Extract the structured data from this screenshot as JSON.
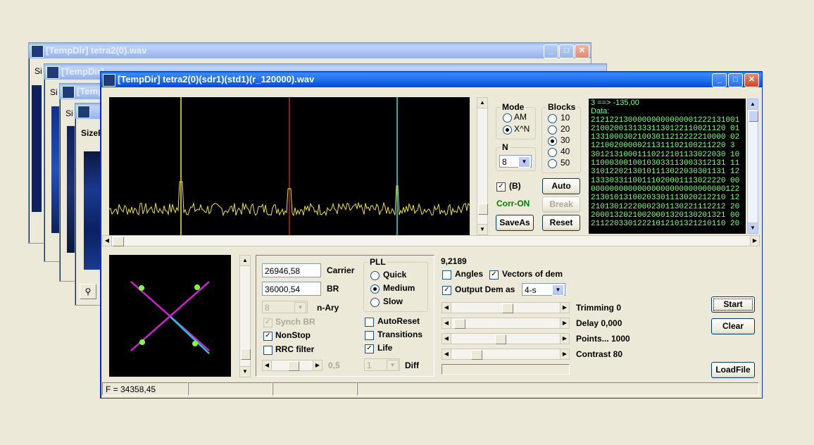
{
  "windows_back": [
    {
      "title": "[TempDir] tetra2(0).wav",
      "size_label": "Si"
    },
    {
      "title": "[TempDir]",
      "size_label": "Si"
    },
    {
      "title": "[TempDir]",
      "size_label": "Si"
    },
    {
      "title": "",
      "size_label": "SizeF"
    }
  ],
  "main": {
    "title": "[TempDir] tetra2(0)(sdr1)(std1)(r_120000).wav",
    "mode": {
      "label": "Mode",
      "options": [
        "AM",
        "X^N"
      ],
      "selected": "X^N"
    },
    "n": {
      "label": "N",
      "value": "8"
    },
    "blocks": {
      "label": "Blocks",
      "options": [
        "10",
        "20",
        "30",
        "40",
        "50"
      ],
      "selected": "30"
    },
    "b_check": {
      "label": "(B)",
      "checked": true
    },
    "corr_status": "Corr-ON",
    "corr_color": "#008000",
    "buttons": {
      "auto": "Auto",
      "break": "Break",
      "saveas": "SaveAs",
      "reset": "Reset",
      "start": "Start",
      "clear": "Clear",
      "loadfile": "LoadFile"
    },
    "data_panel": {
      "header": "3 ==> -135,00",
      "sub": "Data:",
      "lines": [
        "21212213000000000000001222131001",
        "21002001313331130122110021120 01",
        "13310003021003011212222210000 02",
        "12100200000211311102100211220 3",
        "30121310001110212101133022030 10",
        "11000300100103033113003312131 11",
        "31012202130101113022030301131 12",
        "13330331100111020001113022220 00",
        "00000000000000000000000000000122",
        "21301013100203301113020212210 12",
        "21013012220002301130221112212 20",
        "20001320210020001320130201321 00",
        "21122033012221012101321210110 20"
      ],
      "text_color": "#80ff80"
    },
    "carrier": {
      "value": "26946,58",
      "label": "Carrier"
    },
    "br": {
      "value": "36000,54",
      "label": "BR"
    },
    "nary": {
      "value": "8",
      "label": "n-Ary"
    },
    "synch_br": {
      "label": "Synch BR",
      "checked": true,
      "disabled": true
    },
    "nonstop": {
      "label": "NonStop",
      "checked": true
    },
    "rrc": {
      "label": "RRC filter",
      "checked": false
    },
    "rrc_value": "0,5",
    "pll": {
      "label": "PLL",
      "options": [
        "Quick",
        "Medium",
        "Slow"
      ],
      "selected": "Medium"
    },
    "autoreset": {
      "label": "AutoReset",
      "checked": false
    },
    "transitions": {
      "label": "Transitions",
      "checked": false
    },
    "life": {
      "label": "Life",
      "checked": true
    },
    "diff": {
      "value": "1",
      "label": "Diff"
    },
    "value_top": "9,2189",
    "angles": {
      "label": "Angles",
      "checked": false
    },
    "vectors": {
      "label": "Vectors of dem",
      "checked": true
    },
    "output_dem": {
      "label": "Output Dem as",
      "checked": true,
      "value": "4-s"
    },
    "sliders": [
      {
        "label": "Trimming 0",
        "position": 0.52
      },
      {
        "label": "Delay  0,000",
        "position": 0.03
      },
      {
        "label": "Points... 1000",
        "position": 0.45
      },
      {
        "label": "Contrast 80",
        "position": 0.2
      }
    ],
    "status": [
      "F = 34358,45",
      "",
      "",
      ""
    ],
    "spectrum_colors": {
      "trace": "#f0e040",
      "marker1": "#f0f040",
      "marker2": "#c02020",
      "marker3": "#40e0e0"
    },
    "constellation_colors": {
      "line1": "#d020d0",
      "line2": "#20c0e0",
      "points": "#80ff40"
    }
  }
}
